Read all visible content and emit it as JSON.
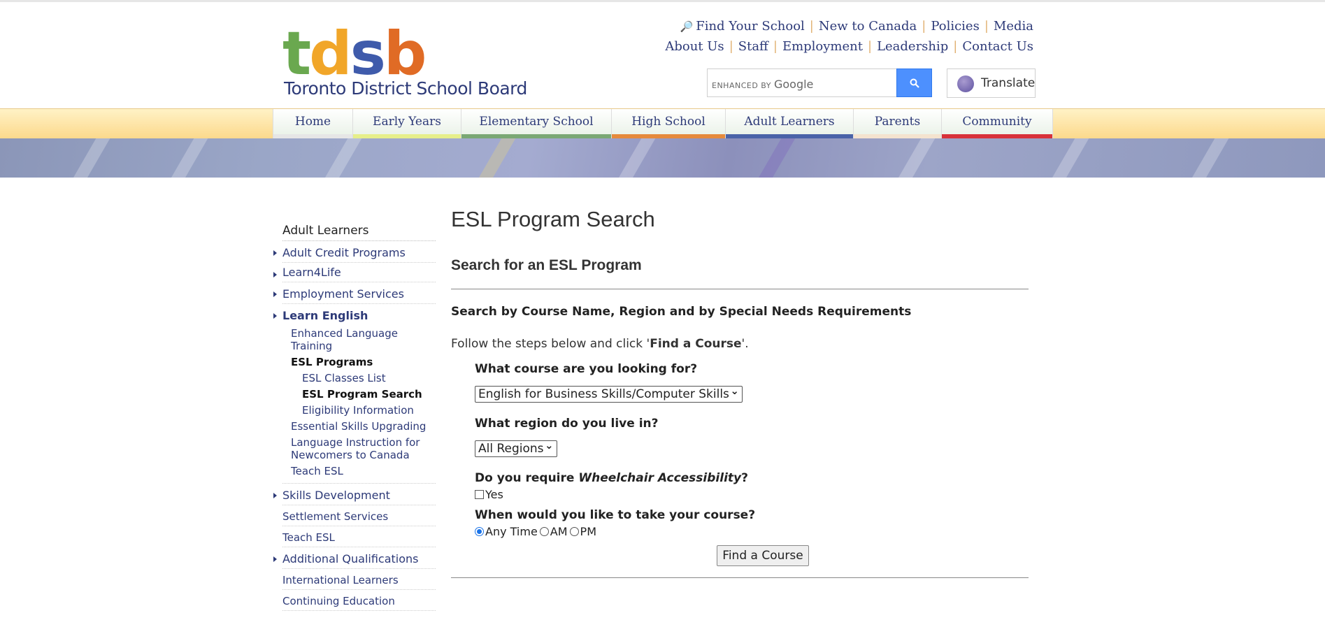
{
  "header": {
    "logo_letters": [
      "t",
      "d",
      "s",
      "b"
    ],
    "logo_colors": [
      "#6aa84f",
      "#f1a629",
      "#3f5bab",
      "#e06b25"
    ],
    "board_name": "Toronto District School Board",
    "util_row1": [
      "Find Your School",
      "New to Canada",
      "Policies",
      "Media"
    ],
    "util_row2": [
      "About Us",
      "Staff",
      "Employment",
      "Leadership",
      "Contact Us"
    ],
    "search": {
      "label_prefix": "ENHANCED BY",
      "label_brand": "Google",
      "button_icon": "search-icon"
    },
    "translate_label": "Translate"
  },
  "nav": [
    {
      "label": "Home",
      "color": "#e6e6e6",
      "width": 114
    },
    {
      "label": "Early Years",
      "color": "#e6ef8a",
      "width": 155
    },
    {
      "label": "Elementary School",
      "color": "#7aa874",
      "width": 215
    },
    {
      "label": "High School",
      "color": "#e58a3c",
      "width": 163
    },
    {
      "label": "Adult Learners",
      "color": "#4a63a8",
      "width": 183
    },
    {
      "label": "Parents",
      "color": "#f4e3cf",
      "width": 126
    },
    {
      "label": "Community",
      "color": "#d8323a",
      "width": 160
    }
  ],
  "sidebar": {
    "heading": "Adult Learners",
    "items": [
      "Adult Credit Programs",
      "Learn4Life",
      "Employment Services",
      "Learn English",
      "Enhanced Language Training",
      "ESL Programs",
      "ESL Classes List",
      "ESL Program Search",
      "Eligibility Information",
      "Essential Skills Upgrading",
      "Language Instruction for Newcomers to Canada",
      "Teach ESL",
      "Skills Development",
      "Settlement Services",
      "Teach ESL",
      "Additional Qualifications",
      "International Learners",
      "Continuing Education"
    ]
  },
  "main": {
    "title": "ESL Program Search",
    "subtitle": "Search for an ESL Program",
    "section": "Search by Course Name, Region and by Special Needs Requirements",
    "intro_before": "Follow the steps below and click '",
    "intro_bold": "Find a Course",
    "intro_after": "'.",
    "q_course": "What course are you looking for?",
    "course_value": "English for Business Skills/Computer Skills",
    "q_region": "What region do you live in?",
    "region_value": "All Regions",
    "q_wheel_before": "Do you require ",
    "q_wheel_em": "Wheelchair Accessibility",
    "q_wheel_after": "?",
    "wheel_yes": "Yes",
    "q_time": "When would you like to take your course?",
    "time_options": [
      "Any Time",
      "AM",
      "PM"
    ],
    "find_button": "Find a Course"
  }
}
